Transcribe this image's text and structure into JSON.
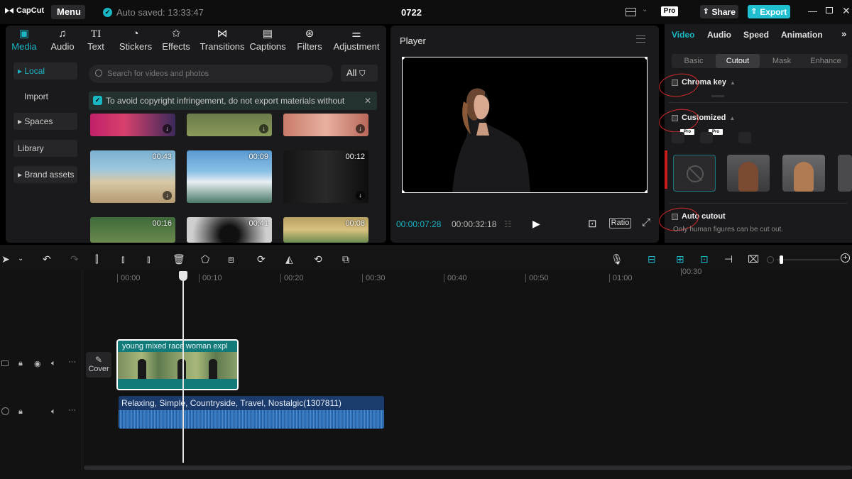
{
  "app": {
    "logo": "CapCut",
    "menu_label": "Menu",
    "autosave_text": "Auto saved: 13:33:47",
    "project_name": "0722",
    "pro_badge": "Pro",
    "share_label": "Share",
    "export_label": "Export",
    "accent_color": "#19b6c4"
  },
  "toolbar_tabs": [
    {
      "label": "Media",
      "icon": "media-icon"
    },
    {
      "label": "Audio",
      "icon": "audio-icon"
    },
    {
      "label": "Text",
      "icon": "text-icon"
    },
    {
      "label": "Stickers",
      "icon": "stickers-icon"
    },
    {
      "label": "Effects",
      "icon": "effects-icon"
    },
    {
      "label": "Transitions",
      "icon": "transitions-icon"
    },
    {
      "label": "Captions",
      "icon": "captions-icon"
    },
    {
      "label": "Filters",
      "icon": "filters-icon"
    },
    {
      "label": "Adjustment",
      "icon": "adjustment-icon"
    }
  ],
  "media_sidebar": [
    {
      "label": "Local"
    },
    {
      "label": "Import"
    },
    {
      "label": "Spaces"
    },
    {
      "label": "Library"
    },
    {
      "label": "Brand assets"
    }
  ],
  "search": {
    "placeholder": "Search for videos and photos",
    "filter_label": "All"
  },
  "copyright_notice": "To avoid copyright infringement, do not export materials without",
  "thumbnails": [
    {
      "duration": "00:43"
    },
    {
      "duration": "00:09"
    },
    {
      "duration": "00:12"
    },
    {
      "duration": "00:16"
    },
    {
      "duration": "00:41"
    },
    {
      "duration": "00:08"
    }
  ],
  "player": {
    "title": "Player",
    "current_time": "00:00:07:28",
    "total_time": "00:00:32:18",
    "ratio_label": "Ratio"
  },
  "properties": {
    "tabs": [
      "Video",
      "Audio",
      "Speed",
      "Animation"
    ],
    "subtabs": [
      "Basic",
      "Cutout",
      "Mask",
      "Enhance"
    ],
    "chroma_key": "Chroma key",
    "customized": "Customized",
    "auto_cutout": "Auto cutout",
    "auto_cutout_desc": "Only human figures can be cut out."
  },
  "timeline": {
    "ruler": [
      "00:00",
      "00:10",
      "00:20",
      "00:30",
      "00:40",
      "00:50",
      "01:00"
    ],
    "right_ruler": "|00:30",
    "cover_label": "Cover",
    "video_clip_title": "young mixed race woman expl",
    "audio_clip_title": "Relaxing, Simple, Countryside, Travel, Nostalgic(1307811)"
  }
}
